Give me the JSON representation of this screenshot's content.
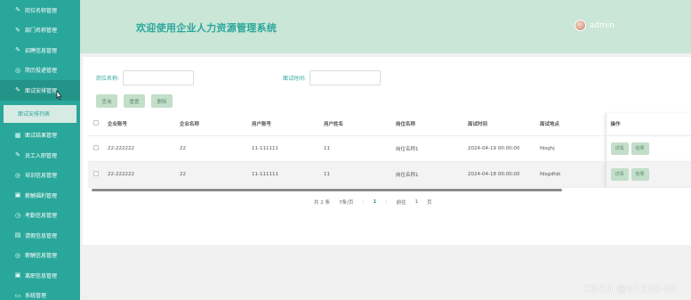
{
  "sidebar": {
    "items": [
      {
        "label": "岗位名称管理",
        "icon": "edit-icon"
      },
      {
        "label": "部门名称管理",
        "icon": "edit-icon"
      },
      {
        "label": "招聘信息管理",
        "icon": "edit-icon"
      },
      {
        "label": "简历投递管理",
        "icon": "chat-icon"
      },
      {
        "label": "面试安排管理",
        "icon": "edit-icon"
      }
    ],
    "active_sub": "面试安排列表",
    "items_after": [
      {
        "label": "面试结果管理",
        "icon": "grid-icon"
      },
      {
        "label": "员工入职管理",
        "icon": "edit-icon"
      },
      {
        "label": "培训信息管理",
        "icon": "chat-icon"
      },
      {
        "label": "薪酬福利管理",
        "icon": "image-icon"
      },
      {
        "label": "考勤信息管理",
        "icon": "clock-icon"
      },
      {
        "label": "请假信息管理",
        "icon": "document-icon"
      },
      {
        "label": "薪酬信息管理",
        "icon": "chat-icon"
      },
      {
        "label": "离职信息管理",
        "icon": "image-icon"
      },
      {
        "label": "系统管理",
        "icon": "monitor-icon"
      }
    ]
  },
  "header": {
    "title": "欢迎使用企业人力资源管理系统",
    "username": "admin"
  },
  "search": {
    "position_label": "岗位名称:",
    "interview_time_label": "面试时间:"
  },
  "buttons": {
    "query": "查询",
    "reset": "重置",
    "delete": "删除"
  },
  "table": {
    "columns": [
      "企业账号",
      "企业名称",
      "用户账号",
      "用户姓名",
      "岗位名称",
      "面试时间",
      "面试地点",
      "操作"
    ],
    "rows": [
      {
        "company_account": "22-222222",
        "company_name": "22",
        "user_account": "11-111111",
        "user_name": "11",
        "position": "岗位名称1",
        "time": "2024-04-19 00:00:00",
        "place": "fdsghj",
        "detail": "详情",
        "result": "结果"
      },
      {
        "company_account": "22-222222",
        "company_name": "22",
        "user_account": "11-111111",
        "user_name": "11",
        "position": "岗位名称1",
        "time": "2024-04-18 00:00:00",
        "place": "fdsgdhjk",
        "detail": "详情",
        "result": "结果"
      }
    ]
  },
  "pagination": {
    "total": "共 2 条",
    "page_size": "7条/页",
    "prev": "‹",
    "current": "1",
    "next": "›",
    "goto_label": "前往",
    "goto_value": "1",
    "page_suffix": "页"
  },
  "watermark": "CSDN @81330-BS",
  "colors": {
    "primary": "#2aa79b",
    "header_bg": "#c9e6d6",
    "button_bg": "#c3dec9"
  }
}
